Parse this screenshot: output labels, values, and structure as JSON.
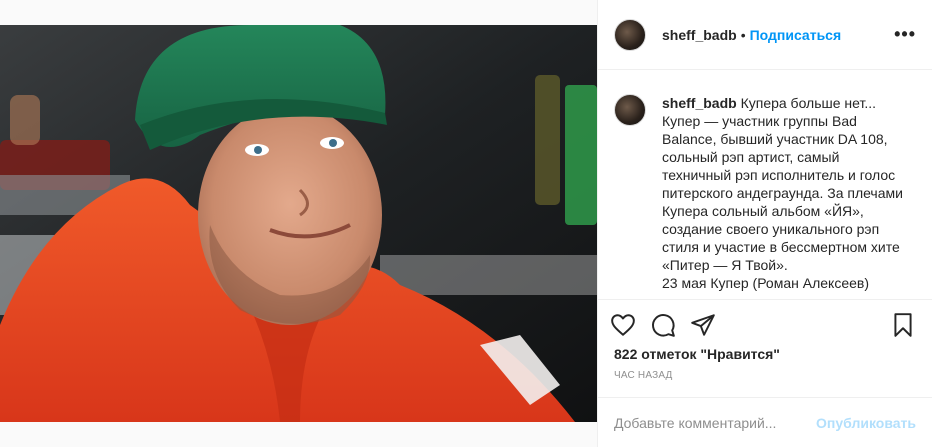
{
  "post": {
    "username": "sheff_badb",
    "follow_label": "Подписаться",
    "dot": "•",
    "more_label": "•••"
  },
  "caption": {
    "username": "sheff_badb",
    "text": " Купера больше нет...\nКупер — участник группы Bad Balance, бывший участник DA 108, сольный рэп артист, самый техничный рэп исполнитель и голос питерского андеграунда. За плечами Купера сольный альбом «ЙЯ», создание своего уникального рэп стиля и участие в бессмертном хите «Питер — Я Твой».\n23 мая Купер (Роман Алексеев)"
  },
  "stats": {
    "likes": "822 отметок \"Нравится\"",
    "time": "ЧАС НАЗАД"
  },
  "comment": {
    "placeholder": "Добавьте комментарий...",
    "post_label": "Опубликовать"
  },
  "icons": [
    "heart-icon",
    "comment-icon",
    "share-icon",
    "bookmark-icon",
    "more-icon"
  ],
  "colors": {
    "accent": "#0095f6",
    "post_disabled": "#b2dffc",
    "jacket": "#e8401c",
    "hat": "#1f7a4a"
  }
}
